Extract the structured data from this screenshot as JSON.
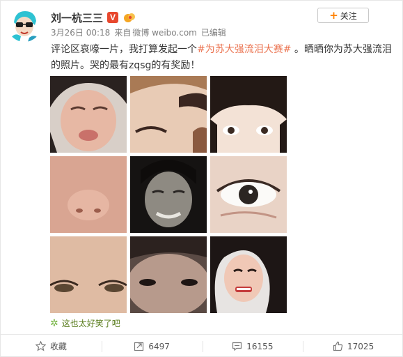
{
  "user": {
    "name": "刘一杭三三",
    "verified_badge": "V"
  },
  "follow_button": {
    "plus": "+",
    "label": "关注"
  },
  "meta": {
    "time": "3月26日 00:18",
    "source_prefix": "来自",
    "source": "微博 weibo.com",
    "edited": "已编辑"
  },
  "post": {
    "text_before": "评论区哀嚎一片，我打算发起一个",
    "hashtag": "#为苏大强流泪大赛#",
    "text_after": " 。晒晒你为苏大强流泪的照片。哭的最有zqsg的有奖励！"
  },
  "photos": [
    {
      "label": "photo-1"
    },
    {
      "label": "photo-2"
    },
    {
      "label": "photo-3"
    },
    {
      "label": "photo-4"
    },
    {
      "label": "photo-5"
    },
    {
      "label": "photo-6"
    },
    {
      "label": "photo-7"
    },
    {
      "label": "photo-8"
    },
    {
      "label": "photo-9"
    }
  ],
  "comment_preview": "这也太好笑了吧",
  "actions": {
    "favorite": "收藏",
    "repost": "6497",
    "comment": "16155",
    "like": "17025"
  },
  "colors": {
    "accent": "#eb7350",
    "follow_plus": "#ff8200",
    "verified": "#e8482e",
    "meta": "#808080"
  }
}
